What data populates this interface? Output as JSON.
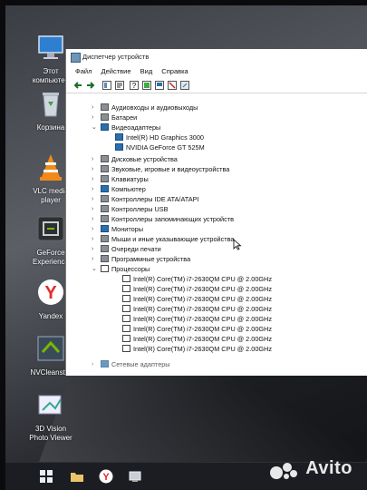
{
  "desktop": {
    "icons": [
      {
        "label": "Этот компьютер",
        "icon": "computer-icon"
      },
      {
        "label": "Корзина",
        "icon": "recycle-bin-icon"
      },
      {
        "label": "VLC media player",
        "icon": "vlc-icon"
      },
      {
        "label": "GeForce Experience",
        "icon": "geforce-icon"
      },
      {
        "label": "Yandex",
        "icon": "yandex-icon"
      },
      {
        "label": "NVCleanst...",
        "icon": "nvcleanstall-icon"
      },
      {
        "label": "3D Vision Photo Viewer",
        "icon": "3d-vision-icon"
      }
    ]
  },
  "window": {
    "title": "Диспетчер устройств",
    "menu": [
      "Файл",
      "Действие",
      "Вид",
      "Справка"
    ]
  },
  "tree": {
    "categories": [
      "Аудиовходы и аудиовыходы",
      "Батареи",
      "Видеоадаптеры",
      "Дисковые устройства",
      "Звуковые, игровые и видеоустройства",
      "Клавиатуры",
      "Компьютер",
      "Контроллеры IDE ATA/ATAPI",
      "Контроллеры USB",
      "Контроллеры запоминающих устройств",
      "Мониторы",
      "Мыши и иные указывающие устройства",
      "Очереди печати",
      "Программные устройства",
      "Процессоры",
      "Сетевые адаптеры"
    ],
    "video_adapters": [
      "Intel(R) HD Graphics 3000",
      "NVIDIA GeForce GT 525M"
    ],
    "processors": [
      "Intel(R) Core(TM) i7-2630QM CPU @ 2.00GHz",
      "Intel(R) Core(TM) i7-2630QM CPU @ 2.00GHz",
      "Intel(R) Core(TM) i7-2630QM CPU @ 2.00GHz",
      "Intel(R) Core(TM) i7-2630QM CPU @ 2.00GHz",
      "Intel(R) Core(TM) i7-2630QM CPU @ 2.00GHz",
      "Intel(R) Core(TM) i7-2630QM CPU @ 2.00GHz",
      "Intel(R) Core(TM) i7-2630QM CPU @ 2.00GHz",
      "Intel(R) Core(TM) i7-2630QM CPU @ 2.00GHz"
    ]
  },
  "watermark": {
    "text": "Avito"
  }
}
